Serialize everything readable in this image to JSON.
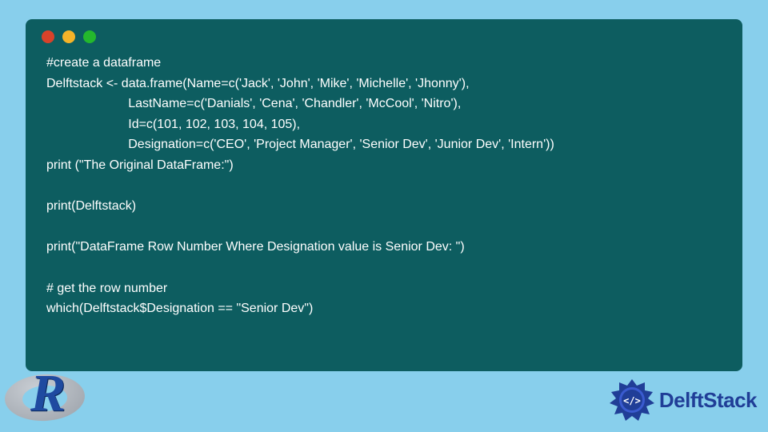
{
  "code": {
    "line1": "#create a dataframe",
    "line2": "Delftstack <- data.frame(Name=c('Jack', 'John', 'Mike', 'Michelle', 'Jhonny'),",
    "line3": "                       LastName=c('Danials', 'Cena', 'Chandler', 'McCool', 'Nitro'),",
    "line4": "                       Id=c(101, 102, 103, 104, 105),",
    "line5": "                       Designation=c('CEO', 'Project Manager', 'Senior Dev', 'Junior Dev', 'Intern'))",
    "line6": "print (\"The Original DataFrame:\")",
    "line7": "",
    "line8": "print(Delftstack)",
    "line9": "",
    "line10": "print(\"DataFrame Row Number Where Designation value is Senior Dev: \")",
    "line11": "",
    "line12": "# get the row number",
    "line13": "which(Delftstack$Designation == \"Senior Dev\")"
  },
  "logos": {
    "r_letter": "R",
    "delftstack_text": "DelftStack",
    "delftstack_glyph": "</>"
  },
  "colors": {
    "page_bg": "#88cfec",
    "window_bg": "#0d5d60",
    "code_fg": "#ffffff",
    "brand_blue": "#203e97"
  }
}
